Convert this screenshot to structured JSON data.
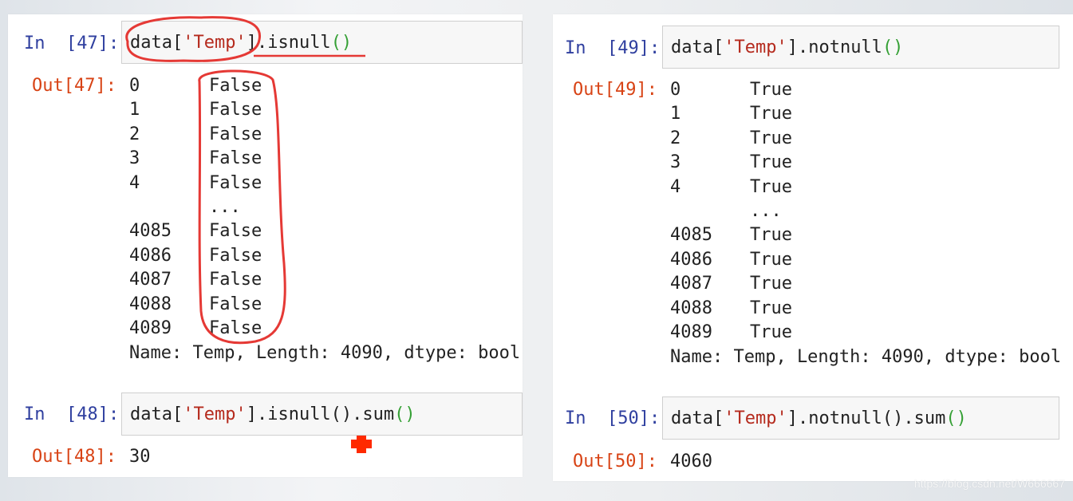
{
  "colors": {
    "in_prompt": "#2f3f9f",
    "out_prompt": "#d84315",
    "string": "#b52a1d",
    "paren": "#35a035",
    "annotation": "#e53935"
  },
  "cells": {
    "c47": {
      "in_prompt": "In  [47]:",
      "code_prefix": "data[",
      "code_str": "'Temp'",
      "code_mid": "].isnull",
      "code_paren": "()",
      "out_prompt": "Out[47]:",
      "rows": [
        {
          "idx": "0",
          "val": "False"
        },
        {
          "idx": "1",
          "val": "False"
        },
        {
          "idx": "2",
          "val": "False"
        },
        {
          "idx": "3",
          "val": "False"
        },
        {
          "idx": "4",
          "val": "False"
        },
        {
          "idx": "",
          "val": "..."
        },
        {
          "idx": "4085",
          "val": "False"
        },
        {
          "idx": "4086",
          "val": "False"
        },
        {
          "idx": "4087",
          "val": "False"
        },
        {
          "idx": "4088",
          "val": "False"
        },
        {
          "idx": "4089",
          "val": "False"
        }
      ],
      "footer": "Name: Temp, Length: 4090, dtype: bool"
    },
    "c48": {
      "in_prompt": "In  [48]:",
      "code_prefix": "data[",
      "code_str": "'Temp'",
      "code_mid": "].isnull().sum",
      "code_paren": "()",
      "out_prompt": "Out[48]:",
      "result": "30"
    },
    "c49": {
      "in_prompt": "In  [49]:",
      "code_prefix": "data[",
      "code_str": "'Temp'",
      "code_mid": "].notnull",
      "code_paren": "()",
      "out_prompt": "Out[49]:",
      "rows": [
        {
          "idx": "0",
          "val": "True"
        },
        {
          "idx": "1",
          "val": "True"
        },
        {
          "idx": "2",
          "val": "True"
        },
        {
          "idx": "3",
          "val": "True"
        },
        {
          "idx": "4",
          "val": "True"
        },
        {
          "idx": "",
          "val": "..."
        },
        {
          "idx": "4085",
          "val": "True"
        },
        {
          "idx": "4086",
          "val": "True"
        },
        {
          "idx": "4087",
          "val": "True"
        },
        {
          "idx": "4088",
          "val": "True"
        },
        {
          "idx": "4089",
          "val": "True"
        }
      ],
      "footer": "Name: Temp, Length: 4090, dtype: bool"
    },
    "c50": {
      "in_prompt": "In  [50]:",
      "code_prefix": "data[",
      "code_str": "'Temp'",
      "code_mid": "].notnull().sum",
      "code_paren": "()",
      "out_prompt": "Out[50]:",
      "result": "4060"
    }
  },
  "watermark": "https://blog.csdn.net/W666667"
}
